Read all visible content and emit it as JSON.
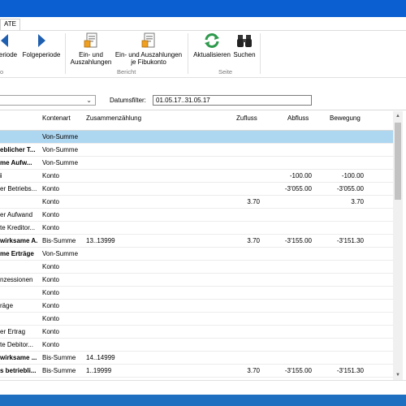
{
  "ribbon": {
    "tab_label": "ATE",
    "buttons": {
      "prev_period": "eriode",
      "next_period": "Folgeperiode",
      "ein_aus_line1": "Ein- und",
      "ein_aus_line2": "Auszahlungen",
      "ein_aus_fibu_line1": "Ein- und Auszahlungen",
      "ein_aus_fibu_line2": "je Fibukonto",
      "refresh": "Aktualisieren",
      "search": "Suchen"
    },
    "groups": {
      "bericht": "Bericht",
      "seite": "Seite",
      "left_partial": "o"
    }
  },
  "filter": {
    "date_label": "Datumsfilter:",
    "date_value": "01.05.17..31.05.17"
  },
  "table": {
    "columns": {
      "kontenart": "Kontenart",
      "zusammenzaehlung": "Zusammenzählung",
      "zufluss": "Zufluss",
      "abfluss": "Abfluss",
      "bewegung": "Bewegung"
    },
    "rows": [
      {
        "name": "",
        "art": "Von-Summe",
        "zus": "",
        "zu": "",
        "ab": "",
        "be": "",
        "bold": false,
        "selected": true
      },
      {
        "name": "eblicher T...",
        "art": "Von-Summe",
        "zus": "",
        "zu": "",
        "ab": "",
        "be": "",
        "bold": true,
        "selected": false
      },
      {
        "name": "me Aufw...",
        "art": "Von-Summe",
        "zus": "",
        "zu": "",
        "ab": "",
        "be": "",
        "bold": true,
        "selected": false
      },
      {
        "name": "i",
        "art": "Konto",
        "zus": "",
        "zu": "",
        "ab": "-100.00",
        "be": "-100.00",
        "bold": true,
        "selected": false
      },
      {
        "name": "er Betriebs...",
        "art": "Konto",
        "zus": "",
        "zu": "",
        "ab": "-3'055.00",
        "be": "-3'055.00",
        "bold": false,
        "selected": false
      },
      {
        "name": "",
        "art": "Konto",
        "zus": "",
        "zu": "3.70",
        "ab": "",
        "be": "3.70",
        "bold": false,
        "selected": false
      },
      {
        "name": "er Aufwand",
        "art": "Konto",
        "zus": "",
        "zu": "",
        "ab": "",
        "be": "",
        "bold": false,
        "selected": false
      },
      {
        "name": "te Kreditor...",
        "art": "Konto",
        "zus": "",
        "zu": "",
        "ab": "",
        "be": "",
        "bold": false,
        "selected": false
      },
      {
        "name": "wirksame A...",
        "art": "Bis-Summe",
        "zus": "13..13999",
        "zu": "3.70",
        "ab": "-3'155.00",
        "be": "-3'151.30",
        "bold": true,
        "selected": false
      },
      {
        "name": "me Erträge",
        "art": "Von-Summe",
        "zus": "",
        "zu": "",
        "ab": "",
        "be": "",
        "bold": true,
        "selected": false
      },
      {
        "name": "",
        "art": "Konto",
        "zus": "",
        "zu": "",
        "ab": "",
        "be": "",
        "bold": false,
        "selected": false
      },
      {
        "name": "nzessionen",
        "art": "Konto",
        "zus": "",
        "zu": "",
        "ab": "",
        "be": "",
        "bold": false,
        "selected": false
      },
      {
        "name": "",
        "art": "Konto",
        "zus": "",
        "zu": "",
        "ab": "",
        "be": "",
        "bold": false,
        "selected": false
      },
      {
        "name": "räge",
        "art": "Konto",
        "zus": "",
        "zu": "",
        "ab": "",
        "be": "",
        "bold": false,
        "selected": false
      },
      {
        "name": "",
        "art": "Konto",
        "zus": "",
        "zu": "",
        "ab": "",
        "be": "",
        "bold": false,
        "selected": false
      },
      {
        "name": "er Ertrag",
        "art": "Konto",
        "zus": "",
        "zu": "",
        "ab": "",
        "be": "",
        "bold": false,
        "selected": false
      },
      {
        "name": "te Debitor...",
        "art": "Konto",
        "zus": "",
        "zu": "",
        "ab": "",
        "be": "",
        "bold": false,
        "selected": false
      },
      {
        "name": "wirksame ...",
        "art": "Bis-Summe",
        "zus": "14..14999",
        "zu": "",
        "ab": "",
        "be": "",
        "bold": true,
        "selected": false
      },
      {
        "name": "s betriebli...",
        "art": "Bis-Summe",
        "zus": "1..19999",
        "zu": "3.70",
        "ab": "-3'155.00",
        "be": "-3'151.30",
        "bold": true,
        "selected": false
      }
    ]
  },
  "colors": {
    "titlebar": "#0b5fd1",
    "selection": "#add6f1",
    "statusbar": "#1e6fbf",
    "nav_arrow": "#1f5fb0",
    "refresh_icon": "#2e9a4c"
  },
  "icons": {
    "prev": "arrow-left-icon",
    "next": "arrow-right-icon",
    "report": "report-document-icon",
    "refresh": "refresh-icon",
    "search": "binoculars-icon",
    "dropdown": "chevron-down-icon"
  }
}
